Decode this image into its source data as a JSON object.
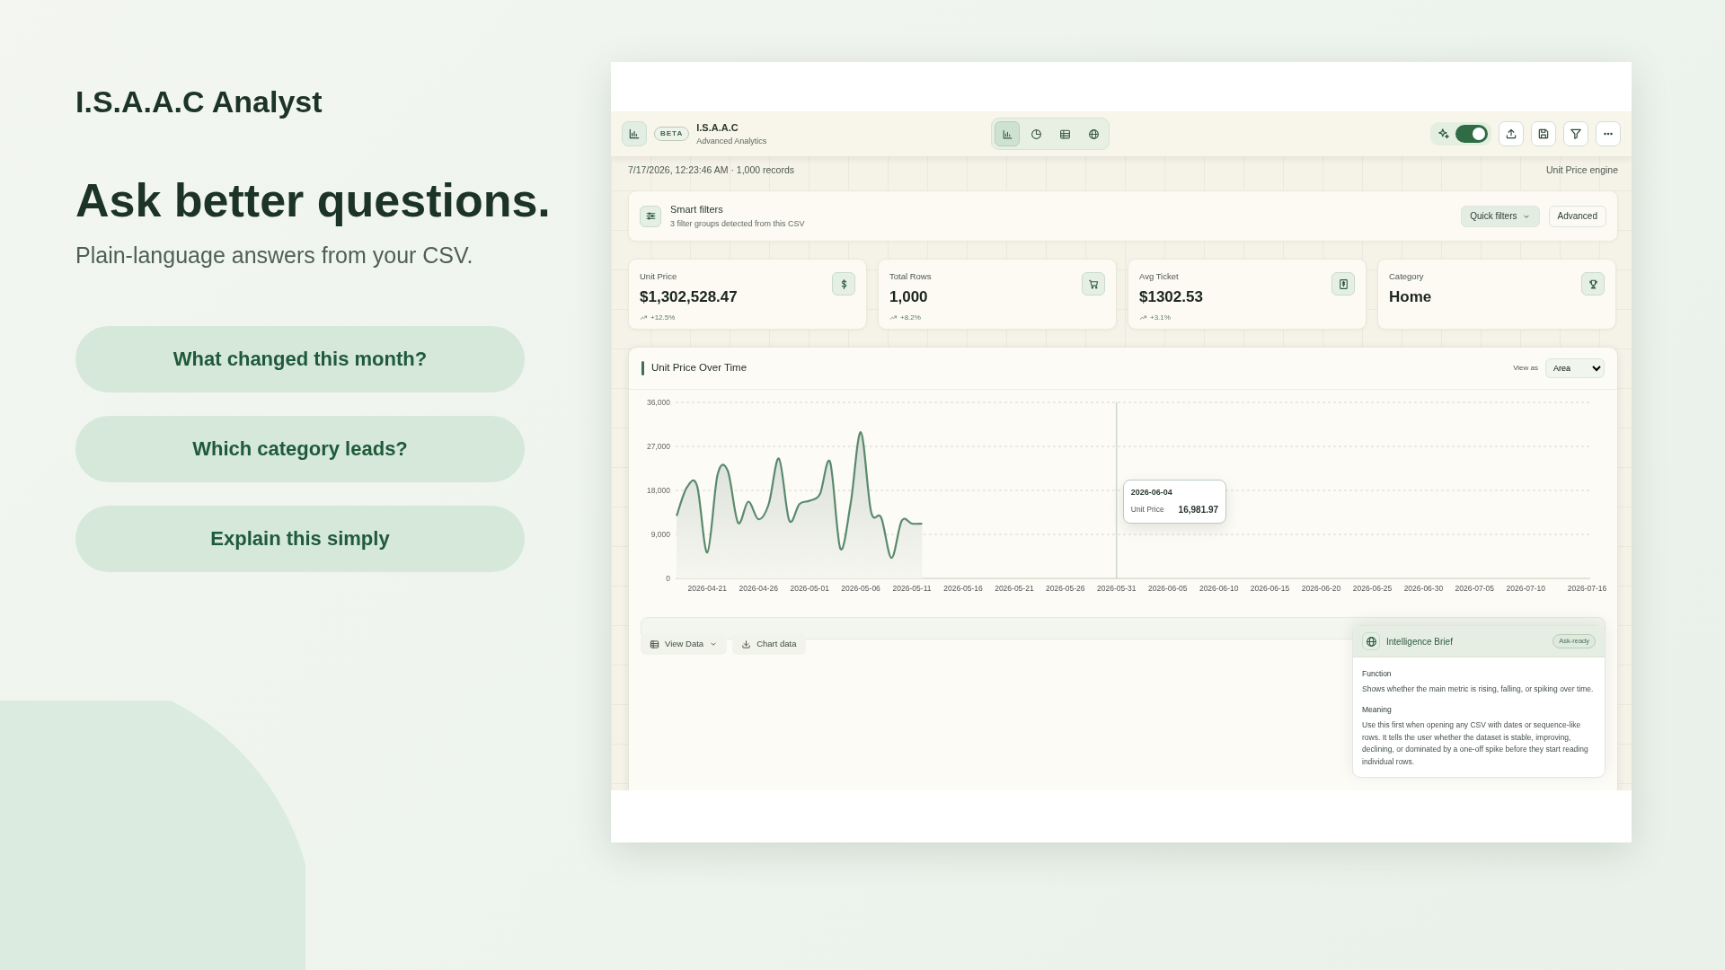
{
  "hero": {
    "brand": "I.S.A.A.C Analyst",
    "headline": "Ask better questions.",
    "subtitle": "Plain-language answers from your CSV.",
    "prompts": [
      "What changed this month?",
      "Which category leads?",
      "Explain this simply"
    ]
  },
  "app": {
    "header": {
      "badge": "BETA",
      "title": "I.S.A.A.C",
      "subtitle": "Advanced Analytics",
      "views": [
        {
          "kind": "bar",
          "selected": true
        },
        {
          "kind": "pie",
          "selected": false
        },
        {
          "kind": "table",
          "selected": false
        },
        {
          "kind": "globe",
          "selected": false
        }
      ],
      "ai_toggle": {
        "on": true
      },
      "tools": [
        {
          "kind": "upload"
        },
        {
          "kind": "save"
        },
        {
          "kind": "filter"
        },
        {
          "kind": "more"
        }
      ]
    },
    "meta": {
      "left": "7/17/2026, 12:23:46 AM · 1,000 records",
      "right": "Unit Price engine"
    },
    "filters": {
      "title": "Smart filters",
      "subtitle": "3 filter groups detected from this CSV",
      "quick": "Quick filters",
      "advanced": "Advanced"
    },
    "kpis": [
      {
        "label": "Unit Price",
        "value": "$1,302,528.47",
        "change": "+12.5%",
        "kind": "dollar"
      },
      {
        "label": "Total Rows",
        "value": "1,000",
        "change": "+8.2%",
        "kind": "cart"
      },
      {
        "label": "Avg Ticket",
        "value": "$1302.53",
        "change": "+3.1%",
        "kind": "receipt"
      },
      {
        "label": "Category",
        "value": "Home",
        "kind": "trophy"
      }
    ],
    "chart": {
      "title": "Unit Price Over Time",
      "view_label": "View as",
      "view_value": "Area",
      "chart_data": {
        "type": "area",
        "categories": [
          null,
          null,
          null,
          "2026-04-21",
          null,
          null,
          null,
          null,
          "2026-04-26",
          null,
          null,
          null,
          null,
          "2026-05-01",
          null,
          null,
          null,
          null,
          "2026-05-06",
          null,
          null,
          null,
          null,
          "2026-05-11",
          null,
          null,
          null,
          null,
          "2026-05-16",
          null,
          null,
          null,
          null,
          "2026-05-21",
          null,
          null,
          null,
          null,
          "2026-05-26",
          null,
          null,
          null,
          null,
          "2026-05-31",
          null,
          null,
          null,
          null,
          "2026-06-05",
          null,
          null,
          null,
          null,
          "2026-06-10",
          null,
          null,
          null,
          null,
          "2026-06-15",
          null,
          null,
          null,
          null,
          "2026-06-20",
          null,
          null,
          null,
          null,
          "2026-06-25",
          null,
          null,
          null,
          null,
          "2026-06-30",
          null,
          null,
          null,
          null,
          "2026-07-05",
          null,
          null,
          null,
          null,
          "2026-07-10",
          null,
          null,
          null,
          null,
          null,
          "2026-07-16"
        ],
        "series": [
          {
            "name": "Unit Price",
            "color": "#5a8a6c",
            "values": [
              12800,
              18600,
              18900,
              5300,
              21200,
              22000,
              11400,
              15700,
              12100,
              15200,
              24500,
              11900,
              15200,
              15900,
              17200,
              23800,
              6100,
              15200,
              29900,
              13700,
              12400,
              4200,
              11800,
              11200,
              11200,
              null,
              null,
              null,
              null,
              null,
              null,
              null,
              null,
              null,
              null,
              null,
              null,
              null,
              null,
              null,
              null,
              null,
              null,
              null,
              null,
              null,
              null,
              null,
              null,
              null,
              null,
              null,
              null,
              null,
              null,
              null,
              null,
              null,
              null,
              null,
              null,
              null,
              null,
              null,
              null,
              null,
              null,
              null,
              null,
              null,
              null,
              null,
              null,
              null,
              null,
              null,
              null,
              null,
              null,
              null,
              null,
              null,
              null,
              null,
              null,
              null,
              null,
              null,
              null,
              null
            ]
          }
        ],
        "ylim": [
          0,
          36000
        ],
        "grid": true,
        "yticks": [
          {
            "value": 0,
            "label": "0"
          },
          {
            "value": 9000,
            "label": "9,000"
          },
          {
            "value": 18000,
            "label": "18,000"
          },
          {
            "value": 27000,
            "label": "27,000"
          },
          {
            "value": 36000,
            "label": "36,000"
          }
        ]
      },
      "tooltip": {
        "date": "2026-06-04",
        "value": "16,981.97"
      }
    },
    "actions": [
      {
        "label": "View Data",
        "kind": "table"
      },
      {
        "label": "Chart data",
        "kind": "download"
      }
    ],
    "brief": {
      "title": "Intelligence Brief",
      "badge": "Ask-ready",
      "sections": [
        {
          "heading": "Function",
          "text": "Shows whether the main metric is rising, falling, or spiking over time."
        },
        {
          "heading": "Meaning",
          "text": "Use this first when opening any CSV with dates or sequence-like rows. It tells the user whether the dataset is stable, improving, declining, or dominated by a one-off spike before they start reading individual rows."
        }
      ]
    }
  }
}
